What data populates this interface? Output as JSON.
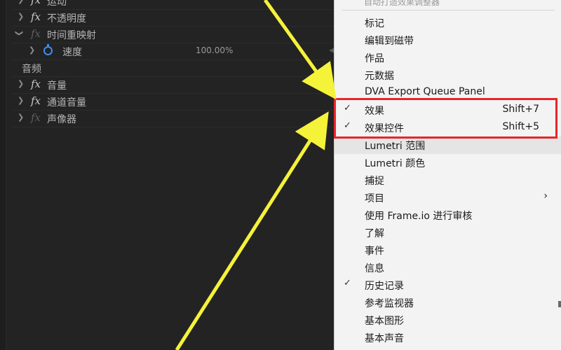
{
  "effect_panel": {
    "rows": [
      {
        "label": "运动"
      },
      {
        "label": "不透明度"
      },
      {
        "label": "时间重映射"
      },
      {
        "label": "速度",
        "value": "100.00%"
      },
      {
        "label": "音频"
      },
      {
        "label": "音量"
      },
      {
        "label": "通道音量"
      },
      {
        "label": "声像器"
      }
    ]
  },
  "menu": {
    "top_partial": "自动打造效果调整器",
    "items": [
      {
        "label": "标记"
      },
      {
        "label": "编辑到磁带"
      },
      {
        "label": "作品"
      },
      {
        "label": "元数据"
      },
      {
        "label": "DVA Export Queue Panel"
      },
      {
        "label": "效果",
        "shortcut": "Shift+7",
        "checked": true
      },
      {
        "label": "效果控件",
        "shortcut": "Shift+5",
        "checked": true
      },
      {
        "label": "Lumetri 范围"
      },
      {
        "label": "Lumetri 颜色"
      },
      {
        "label": "捕捉"
      },
      {
        "label": "项目",
        "has_submenu": true
      },
      {
        "label": "使用 Frame.io 进行审核"
      },
      {
        "label": "了解"
      },
      {
        "label": "事件"
      },
      {
        "label": "信息"
      },
      {
        "label": "历史记录",
        "checked": true
      },
      {
        "label": "参考监视器"
      },
      {
        "label": "基本图形"
      },
      {
        "label": "基本声音"
      }
    ]
  },
  "colors": {
    "highlight": "#e8262c",
    "arrow": "#f5f23a",
    "stopwatch": "#3f8ef0"
  },
  "icons": {
    "check": "checkmark-icon",
    "submenu": "chevron-right-icon",
    "fx": "fx-icon",
    "stopwatch": "stopwatch-icon"
  }
}
